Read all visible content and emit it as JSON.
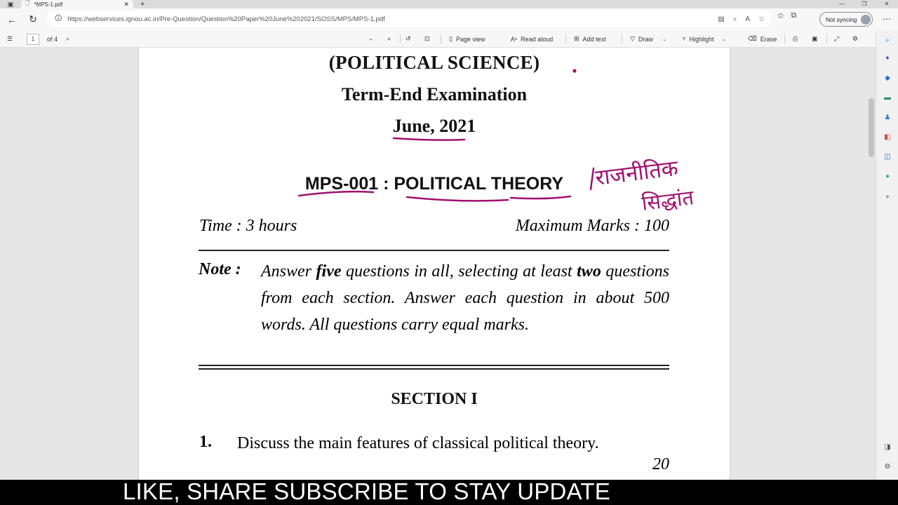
{
  "browser": {
    "tab_title": "*MPS-1.pdf",
    "url": "https://webservices.ignou.ac.in/Pre-Question/Question%20Paper%20June%202021/SOSS/MPS/MPS-1.pdf",
    "profile_label": "Not syncing"
  },
  "pdf_toolbar": {
    "page_current": "1",
    "page_total": "of 4",
    "page_view": "Page view",
    "read_aloud": "Read aloud",
    "add_text": "Add text",
    "draw": "Draw",
    "highlight": "Highlight",
    "erase": "Erase"
  },
  "document": {
    "subject": "(POLITICAL SCIENCE)",
    "exam": "Term-End Examination",
    "session": "June, 2021",
    "course_code": "MPS-001",
    "course_sep": ":",
    "course_title": "POLITICAL THEORY",
    "time": "Time : 3 hours",
    "max_marks": "Maximum Marks : 100",
    "note_label": "Note :",
    "note_parts": {
      "p1": "Answer ",
      "b1": "five",
      "p2": " questions in all, selecting at least ",
      "b2": "two",
      "p3": " questions from each section. Answer each question in about 500 words. All questions carry equal marks."
    },
    "section_title": "SECTION I",
    "q1_num": "1.",
    "q1_text": "Discuss the main features of classical political theory.",
    "q1_marks": "20"
  },
  "annotations": {
    "ink_color": "#a0106e",
    "hindi_line1": "राजनीतिक",
    "hindi_line2": "सिद्धांत"
  },
  "caption": "LIKE, SHARE SUBSCRIBE TO STAY UPDATE"
}
